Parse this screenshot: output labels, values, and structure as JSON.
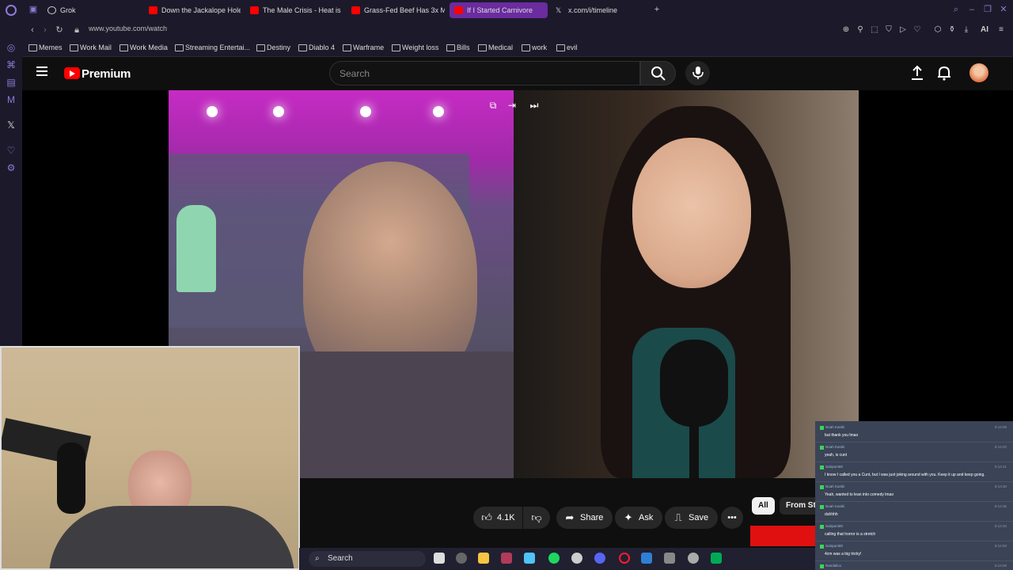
{
  "browser": {
    "tabs": [
      {
        "label": "Grok",
        "active": false
      },
      {
        "label": "Down the Jackalope Hole",
        "active": false
      },
      {
        "label": "The Male Crisis - Heat is V",
        "active": false
      },
      {
        "label": "Grass-Fed Beef Has 3x M",
        "active": false
      },
      {
        "label": "If I Started Carnivore",
        "active": true
      },
      {
        "label": "x.com/i/timeline",
        "active": false
      }
    ],
    "url": "www.youtube.com/watch",
    "ai_label": "AI",
    "bookmarks": [
      "Memes",
      "Work Mail",
      "Work Media",
      "Streaming Entertai...",
      "Destiny",
      "Diablo 4",
      "Warframe",
      "Weight loss",
      "Bills",
      "Medical",
      "work",
      "evil"
    ]
  },
  "youtube": {
    "brand": "Premium",
    "search_placeholder": "Search",
    "actions": {
      "like_count": "4.1K",
      "share": "Share",
      "ask": "Ask",
      "save": "Save"
    },
    "chips": [
      "All",
      "From St"
    ]
  },
  "taskbar": {
    "search_label": "Search"
  },
  "chat": {
    "messages": [
      {
        "name": "Noah Kaniki",
        "time": "8:14:08",
        "text": "but thank you lmao"
      },
      {
        "name": "Noah Kaniki",
        "time": "8:14:20",
        "text": "yeah, is cunt"
      },
      {
        "name": "Subpar480",
        "time": "8:14:21",
        "text": "I know I called you a Cunt, but I was just joking around with you. Keep it up and keep going."
      },
      {
        "name": "Noah Kaniki",
        "time": "8:14:30",
        "text": "Yeah, wanted to lean into comedy lmao"
      },
      {
        "name": "Noah Kaniki",
        "time": "8:14:35",
        "text": "duhhhh"
      },
      {
        "name": "Subpar480",
        "time": "8:14:40",
        "text": "calling that horror is a stretch"
      },
      {
        "name": "Subpar480",
        "time": "8:14:50",
        "text": "4cm was a big tricky!"
      },
      {
        "name": "Randallo1",
        "time": "8:14:59",
        "text": ""
      }
    ]
  },
  "colors": {
    "yt_red": "#ff0000",
    "opera_bg": "#1c1a2a",
    "active_tab": "#6a2c9e",
    "chat_bg": "#3a4456"
  }
}
